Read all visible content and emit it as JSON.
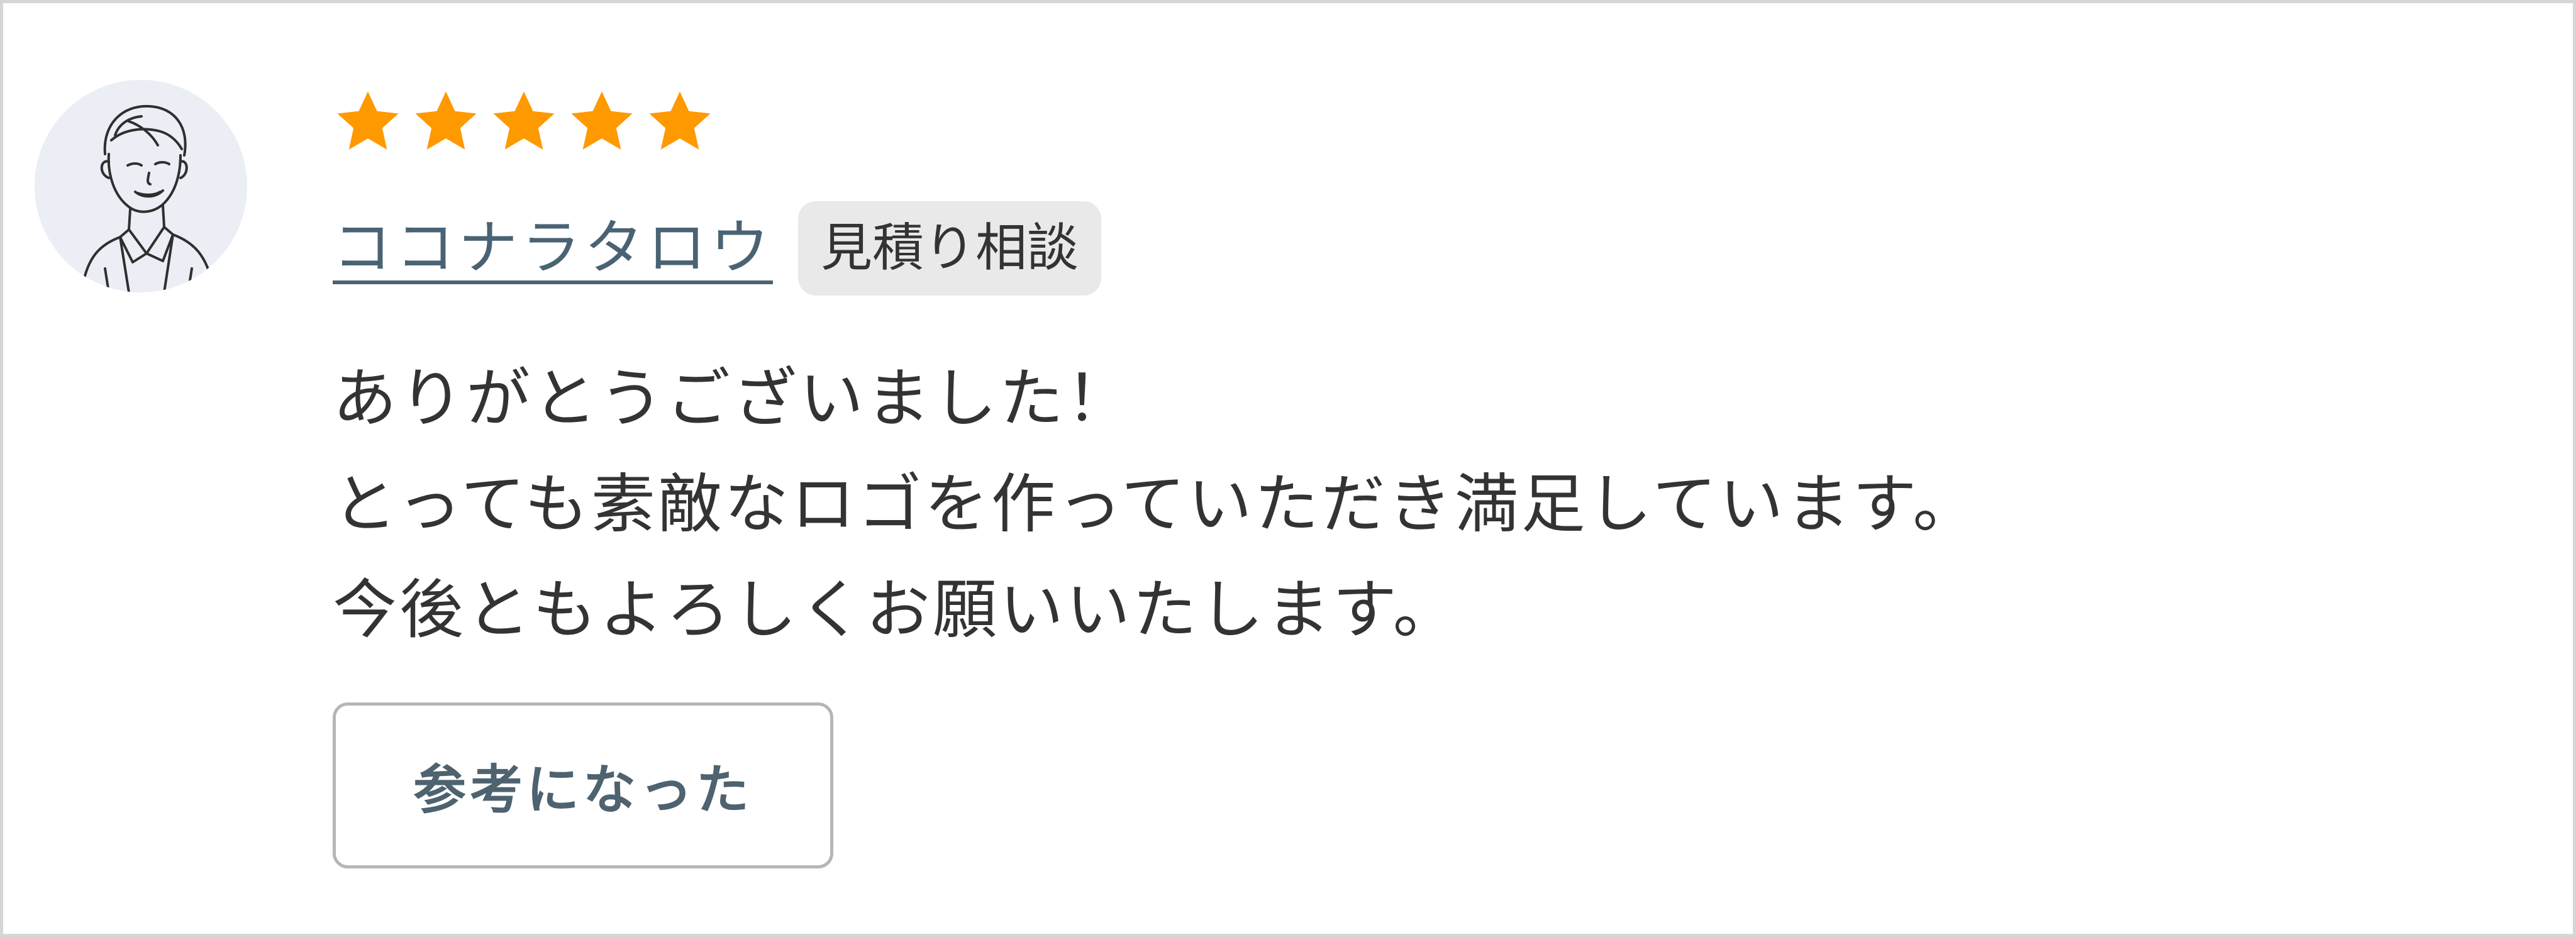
{
  "review": {
    "avatar_icon": "person-illustration-icon",
    "rating": {
      "value": 5,
      "max": 5,
      "star_color": "#FF9900"
    },
    "reviewer_name": "ココナラタロウ",
    "tag": "見積り相談",
    "comment_lines": [
      "ありがとうございました！",
      "とっても素敵なロゴを作っていただき満足しています。",
      "今後ともよろしくお願いいたします。"
    ],
    "helpful_label": "参考になった"
  },
  "colors": {
    "link": "#4A6374",
    "text": "#333333",
    "tag_bg": "#E9E9EA",
    "border": "#D6D6D6",
    "button_border": "#B6B6B6"
  }
}
